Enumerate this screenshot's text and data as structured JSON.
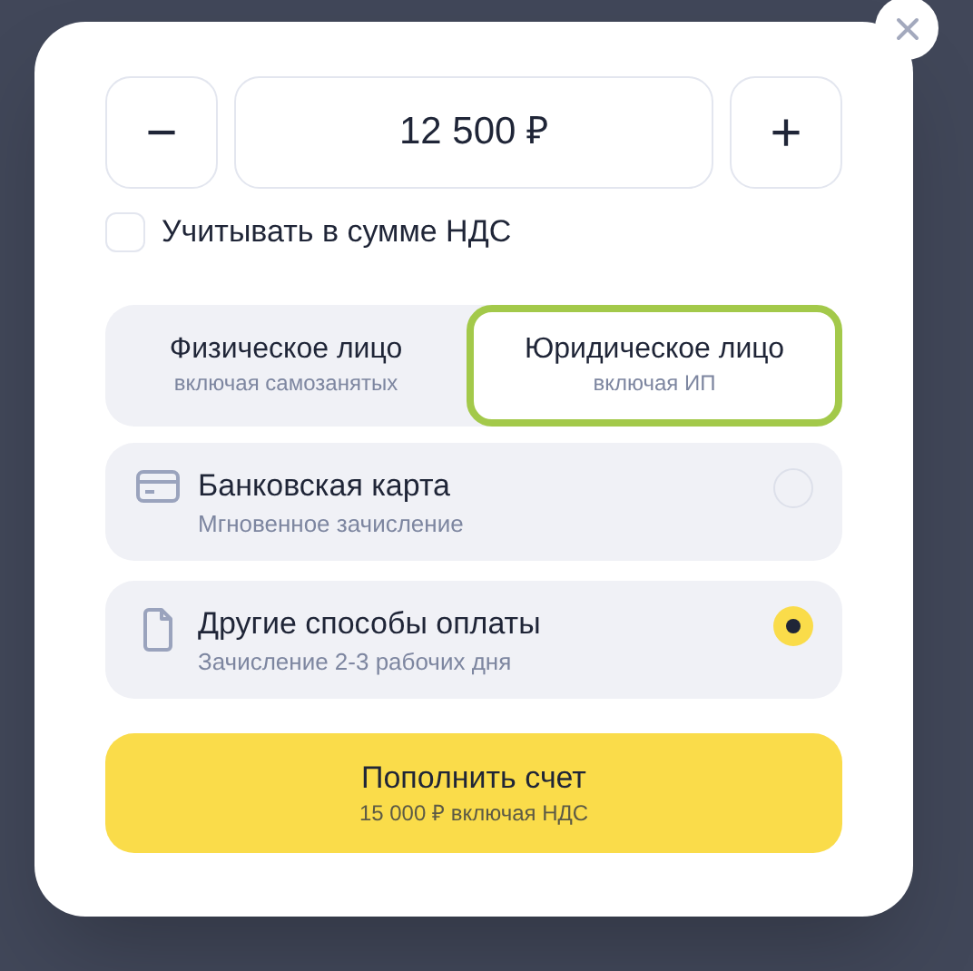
{
  "amount": {
    "decrement": "−",
    "value": "12 500 ₽",
    "increment": "+"
  },
  "vat_checkbox": {
    "label": "Учитывать в сумме НДС",
    "checked": false
  },
  "payer_types": [
    {
      "title": "Физическое лицо",
      "subtitle": "включая самозанятых",
      "selected": false
    },
    {
      "title": "Юридическое лицо",
      "subtitle": "включая ИП",
      "selected": true
    }
  ],
  "payment_methods": [
    {
      "kind": "card",
      "title": "Банковская карта",
      "subtitle": "Мгновенное зачисление",
      "selected": false
    },
    {
      "kind": "document",
      "title": "Другие способы оплаты",
      "subtitle": "Зачисление 2-3 рабочих дня",
      "selected": true
    }
  ],
  "submit": {
    "title": "Пополнить счет",
    "subtitle": "15 000 ₽ включая НДС"
  }
}
